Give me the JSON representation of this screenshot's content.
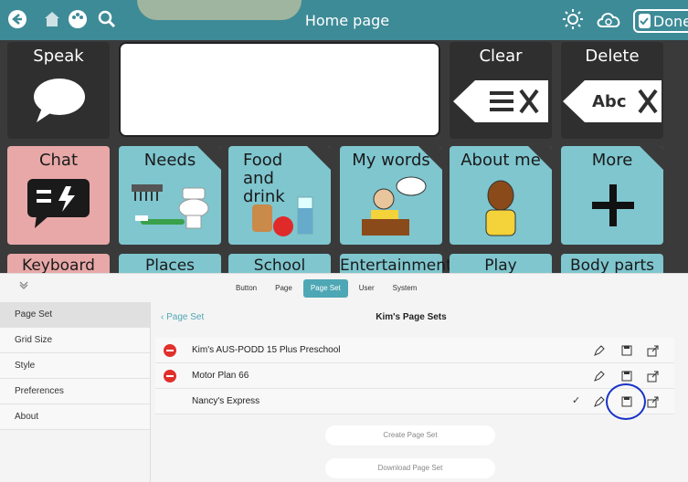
{
  "topbar": {
    "title": "Home page",
    "done_label": "Done"
  },
  "grid": {
    "speak_label": "Speak",
    "clear_label": "Clear",
    "delete_label": "Delete",
    "delete_icon_text": "Abc",
    "row2": [
      {
        "label": "Chat",
        "color": "#e8a8a8"
      },
      {
        "label": "Needs",
        "color": "#7fc6cf"
      },
      {
        "label": "Food and drink",
        "color": "#7fc6cf"
      },
      {
        "label": "My words",
        "color": "#7fc6cf"
      },
      {
        "label": "About me",
        "color": "#7fc6cf"
      },
      {
        "label": "More",
        "color": "#7fc6cf"
      }
    ],
    "row3": [
      {
        "label": "Keyboard"
      },
      {
        "label": "Places"
      },
      {
        "label": "School"
      },
      {
        "label": "Entertainment"
      },
      {
        "label": "Play"
      },
      {
        "label": "Body parts"
      }
    ]
  },
  "editor": {
    "tabs": [
      {
        "label": "Button",
        "active": false
      },
      {
        "label": "Page",
        "active": false
      },
      {
        "label": "Page Set",
        "active": true
      },
      {
        "label": "User",
        "active": false
      },
      {
        "label": "System",
        "active": false
      }
    ],
    "sidebar": [
      "Page Set",
      "Grid Size",
      "Style",
      "Preferences",
      "About"
    ],
    "back_label": "Page Set",
    "title": "Kim's Page Sets",
    "page_sets": [
      {
        "name": "Kim's AUS-PODD 15 Plus Preschool"
      },
      {
        "name": "Motor Plan 66"
      },
      {
        "name": "Nancy's Express"
      }
    ],
    "create_label": "Create Page Set",
    "download_label": "Download Page Set"
  }
}
